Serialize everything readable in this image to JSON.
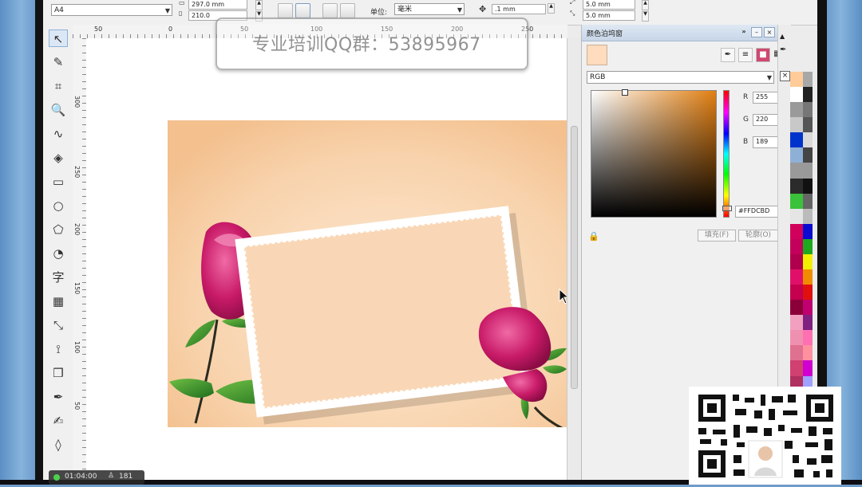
{
  "propbar": {
    "paper_size": "A4",
    "width": "297.0 mm",
    "height": "210.0",
    "units_label": "单位:",
    "units_value": "毫米",
    "nudge": ".1 mm",
    "dup_x": "5.0 mm",
    "dup_y": "5.0 mm"
  },
  "ruler": {
    "h_ticks": [
      "50",
      "0",
      "50",
      "100",
      "150",
      "200",
      "250"
    ],
    "v_ticks": [
      "300",
      "250",
      "200",
      "150",
      "100",
      "50"
    ]
  },
  "tools": [
    {
      "name": "pick-tool",
      "glyph": "↖"
    },
    {
      "name": "shape-tool",
      "glyph": "✎"
    },
    {
      "name": "crop-tool",
      "glyph": "⌗"
    },
    {
      "name": "zoom-tool",
      "glyph": "🔍"
    },
    {
      "name": "freehand-tool",
      "glyph": "∿"
    },
    {
      "name": "smart-fill-tool",
      "glyph": "◈"
    },
    {
      "name": "rectangle-tool",
      "glyph": "▭"
    },
    {
      "name": "ellipse-tool",
      "glyph": "○"
    },
    {
      "name": "polygon-tool",
      "glyph": "⬠"
    },
    {
      "name": "basic-shapes-tool",
      "glyph": "◔"
    },
    {
      "name": "text-tool",
      "glyph": "字"
    },
    {
      "name": "table-tool",
      "glyph": "▦"
    },
    {
      "name": "dimension-tool",
      "glyph": "⤡"
    },
    {
      "name": "connector-tool",
      "glyph": "⟟"
    },
    {
      "name": "shadow-tool",
      "glyph": "❒"
    },
    {
      "name": "eyedropper-tool",
      "glyph": "✒"
    },
    {
      "name": "outline-tool",
      "glyph": "✍"
    },
    {
      "name": "fill-tool",
      "glyph": "◊"
    }
  ],
  "docker": {
    "title": "颜色泊坞窗",
    "color_model": "RGB",
    "r_label": "R",
    "r_value": "255",
    "g_label": "G",
    "g_value": "220",
    "b_label": "B",
    "b_value": "189",
    "hex_value": "#FFDCBD",
    "fill_button": "填充(F)",
    "outline_button": "轮廓(O)",
    "current_color": "#FFDCBD"
  },
  "palette": {
    "column1": [
      "#ffcc99",
      "#ffffff",
      "#9a9a9a",
      "#c8c8c8",
      "#0033cc",
      "#8fb0d6",
      "#9a9a9a",
      "#2b2b2b",
      "#3ac23a",
      "#e5e5e5",
      "#d1005b",
      "#c3005a",
      "#b0004d",
      "#e0106a",
      "#c4004f",
      "#8c003a",
      "#f2a0c0",
      "#f090b0",
      "#e07090",
      "#d04070",
      "#b03060",
      "#902040"
    ],
    "column2": [
      "#a8a8a8",
      "#222",
      "#777",
      "#555",
      "#dadada",
      "#444",
      "#999",
      "#111",
      "#666",
      "#bbb",
      "#0a0ad0",
      "#1ea81e",
      "#f0f000",
      "#f08c00",
      "#e01010",
      "#c00070",
      "#802080",
      "#ff70b0",
      "#ff90a0",
      "#d000d0",
      "#a0a0ff",
      "#ffe0f0"
    ]
  },
  "watermark": "专业培训QQ群：53895967",
  "timer": {
    "time": "01:04:00",
    "viewers": "181"
  }
}
